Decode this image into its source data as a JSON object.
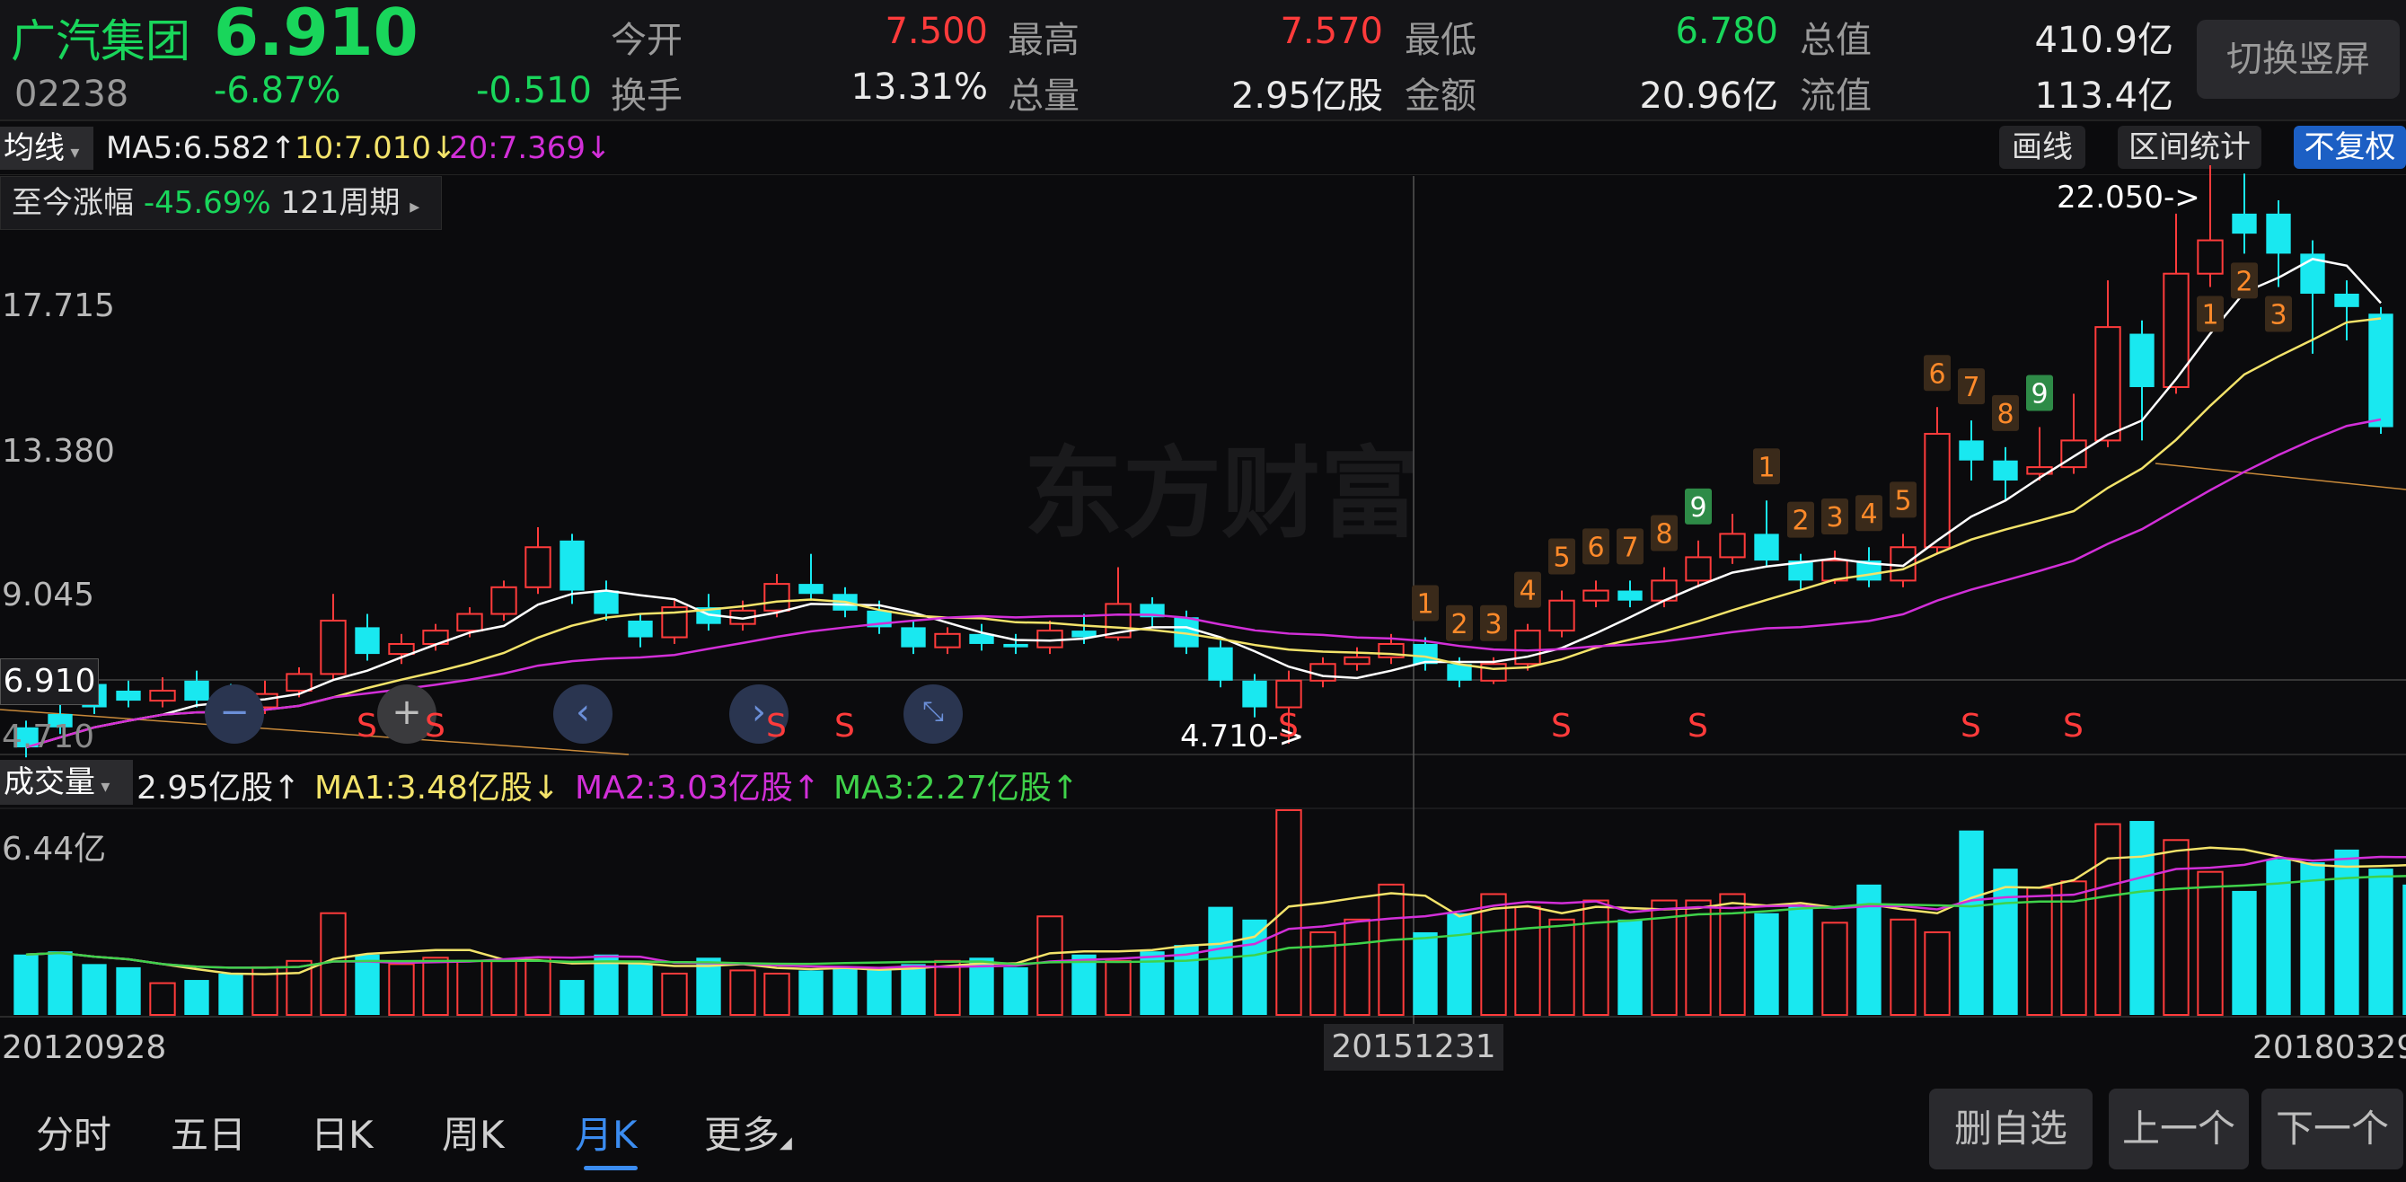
{
  "header": {
    "name": "广汽集团",
    "price": "6.910",
    "code": "02238",
    "change_pct": "-6.87%",
    "change_amt": "-0.510",
    "open_label": "今开",
    "open_value": "7.500",
    "high_label": "最高",
    "high_value": "7.570",
    "low_label": "最低",
    "low_value": "6.780",
    "mktcap_label": "总值",
    "mktcap_value": "410.9亿",
    "turnover_label": "换手",
    "turnover_value": "13.31%",
    "volume_label": "总量",
    "volume_value": "2.95亿股",
    "amount_label": "金额",
    "amount_value": "20.96亿",
    "float_label": "流值",
    "float_value": "113.4亿",
    "switch_label": "切换竖屏"
  },
  "ma_bar": {
    "selector": "均线",
    "ma5": "MA5:6.582↑",
    "ma10": "10:7.010↓",
    "ma20": "20:7.369↓",
    "draw_label": "画线",
    "stats_label": "区间统计",
    "fq_label": "不复权"
  },
  "range": {
    "label": "至今涨幅",
    "pct": "-45.69%",
    "periods": "121周期"
  },
  "watermark": "东方财富",
  "y_axis": [
    "17.715",
    "13.380",
    "9.045"
  ],
  "current_price_tag": "6.910",
  "low_axis_label": "4.710",
  "annotations": {
    "high": "22.050->",
    "low": "4.710->"
  },
  "signal_label": "S",
  "td_up": [
    "1",
    "2",
    "3",
    "4",
    "5",
    "6",
    "7",
    "8",
    "9"
  ],
  "td_up2": [
    "1",
    "2",
    "3",
    "4",
    "5",
    "6",
    "7",
    "8",
    "9"
  ],
  "td_down": [
    "1",
    "2",
    "3"
  ],
  "volume": {
    "selector": "成交量",
    "current": "2.95亿股↑",
    "ma1": "MA1:3.48亿股↓",
    "ma2": "MA2:3.03亿股↑",
    "ma3": "MA3:2.27亿股↑",
    "max": "6.44亿"
  },
  "dates": {
    "start": "20120928",
    "mid": "20151231",
    "end": "20180329"
  },
  "bottom_tabs": [
    "分时",
    "五日",
    "日K",
    "周K",
    "月K",
    "更多"
  ],
  "active_tab": "月K",
  "bottom_buttons": {
    "remove": "删自选",
    "prev": "上一个",
    "next": "下一个"
  },
  "colors": {
    "up": "#ff3b3b",
    "down": "#19d65b",
    "down_candle": "#19e8f0",
    "ma5": "#ffffff",
    "ma10": "#f3e36a",
    "ma20": "#d22fd8",
    "vol_ma3": "#3fd24a"
  },
  "chart_data": {
    "type": "candlestick",
    "period": "monthly",
    "price_scale": {
      "top_label": 17.715,
      "mid_label": 13.38,
      "low_label": 9.045,
      "high": 22.05,
      "low": 4.71
    },
    "candles": [
      {
        "o": 5.2,
        "c": 4.6,
        "h": 5.4,
        "l": 4.3
      },
      {
        "o": 5.6,
        "c": 5.2,
        "h": 6.0,
        "l": 5.0
      },
      {
        "o": 6.5,
        "c": 5.8,
        "h": 6.9,
        "l": 5.6
      },
      {
        "o": 6.3,
        "c": 6.0,
        "h": 6.6,
        "l": 5.8
      },
      {
        "o": 6.0,
        "c": 6.3,
        "h": 6.7,
        "l": 5.8
      },
      {
        "o": 6.6,
        "c": 6.0,
        "h": 6.9,
        "l": 5.8
      },
      {
        "o": 6.2,
        "c": 5.7,
        "h": 6.5,
        "l": 5.4
      },
      {
        "o": 5.8,
        "c": 6.2,
        "h": 6.6,
        "l": 5.6
      },
      {
        "o": 6.3,
        "c": 6.8,
        "h": 7.0,
        "l": 6.1
      },
      {
        "o": 6.8,
        "c": 8.4,
        "h": 9.2,
        "l": 6.6
      },
      {
        "o": 8.2,
        "c": 7.4,
        "h": 8.6,
        "l": 7.2
      },
      {
        "o": 7.4,
        "c": 7.7,
        "h": 8.0,
        "l": 7.1
      },
      {
        "o": 7.7,
        "c": 8.1,
        "h": 8.3,
        "l": 7.5
      },
      {
        "o": 8.1,
        "c": 8.6,
        "h": 8.8,
        "l": 7.9
      },
      {
        "o": 8.6,
        "c": 9.4,
        "h": 9.6,
        "l": 8.4
      },
      {
        "o": 9.4,
        "c": 10.6,
        "h": 11.2,
        "l": 9.2
      },
      {
        "o": 10.8,
        "c": 9.3,
        "h": 11.0,
        "l": 8.9
      },
      {
        "o": 9.3,
        "c": 8.6,
        "h": 9.6,
        "l": 8.4
      },
      {
        "o": 8.4,
        "c": 7.9,
        "h": 8.6,
        "l": 7.6
      },
      {
        "o": 7.9,
        "c": 8.8,
        "h": 9.0,
        "l": 7.7
      },
      {
        "o": 8.8,
        "c": 8.3,
        "h": 9.2,
        "l": 8.1
      },
      {
        "o": 8.3,
        "c": 8.7,
        "h": 9.0,
        "l": 8.1
      },
      {
        "o": 8.7,
        "c": 9.5,
        "h": 9.8,
        "l": 8.5
      },
      {
        "o": 9.5,
        "c": 9.2,
        "h": 10.4,
        "l": 9.0
      },
      {
        "o": 9.2,
        "c": 8.7,
        "h": 9.4,
        "l": 8.5
      },
      {
        "o": 8.7,
        "c": 8.2,
        "h": 9.0,
        "l": 8.0
      },
      {
        "o": 8.2,
        "c": 7.6,
        "h": 8.4,
        "l": 7.4
      },
      {
        "o": 7.6,
        "c": 8.0,
        "h": 8.2,
        "l": 7.4
      },
      {
        "o": 8.0,
        "c": 7.7,
        "h": 8.3,
        "l": 7.5
      },
      {
        "o": 7.7,
        "c": 7.6,
        "h": 8.0,
        "l": 7.4
      },
      {
        "o": 7.6,
        "c": 8.1,
        "h": 8.4,
        "l": 7.4
      },
      {
        "o": 8.1,
        "c": 7.9,
        "h": 8.6,
        "l": 7.7
      },
      {
        "o": 7.9,
        "c": 8.9,
        "h": 10.0,
        "l": 7.8
      },
      {
        "o": 8.9,
        "c": 8.5,
        "h": 9.1,
        "l": 8.2
      },
      {
        "o": 8.5,
        "c": 7.6,
        "h": 8.7,
        "l": 7.4
      },
      {
        "o": 7.6,
        "c": 6.6,
        "h": 7.8,
        "l": 6.4
      },
      {
        "o": 6.6,
        "c": 5.8,
        "h": 6.8,
        "l": 5.5
      },
      {
        "o": 5.8,
        "c": 6.6,
        "h": 6.9,
        "l": 4.71
      },
      {
        "o": 6.6,
        "c": 7.1,
        "h": 7.3,
        "l": 6.4
      },
      {
        "o": 7.1,
        "c": 7.3,
        "h": 7.6,
        "l": 6.9
      },
      {
        "o": 7.3,
        "c": 7.7,
        "h": 8.0,
        "l": 7.1
      },
      {
        "o": 7.7,
        "c": 7.1,
        "h": 7.9,
        "l": 6.9
      },
      {
        "o": 7.1,
        "c": 6.6,
        "h": 7.3,
        "l": 6.4
      },
      {
        "o": 6.6,
        "c": 7.1,
        "h": 7.3,
        "l": 6.5
      },
      {
        "o": 7.1,
        "c": 8.1,
        "h": 8.3,
        "l": 6.9
      },
      {
        "o": 8.1,
        "c": 9.0,
        "h": 9.3,
        "l": 7.9
      },
      {
        "o": 9.0,
        "c": 9.3,
        "h": 9.6,
        "l": 8.8
      },
      {
        "o": 9.3,
        "c": 9.0,
        "h": 9.6,
        "l": 8.8
      },
      {
        "o": 9.0,
        "c": 9.6,
        "h": 10.0,
        "l": 8.8
      },
      {
        "o": 9.6,
        "c": 10.3,
        "h": 10.8,
        "l": 9.4
      },
      {
        "o": 10.3,
        "c": 11.0,
        "h": 11.6,
        "l": 10.1
      },
      {
        "o": 11.0,
        "c": 10.2,
        "h": 12.0,
        "l": 10.0
      },
      {
        "o": 10.2,
        "c": 9.6,
        "h": 10.4,
        "l": 9.3
      },
      {
        "o": 9.6,
        "c": 10.2,
        "h": 10.5,
        "l": 9.5
      },
      {
        "o": 10.2,
        "c": 9.6,
        "h": 10.6,
        "l": 9.4
      },
      {
        "o": 9.6,
        "c": 10.6,
        "h": 11.0,
        "l": 9.4
      },
      {
        "o": 10.6,
        "c": 14.0,
        "h": 14.8,
        "l": 10.4
      },
      {
        "o": 13.8,
        "c": 13.2,
        "h": 14.4,
        "l": 12.6
      },
      {
        "o": 13.2,
        "c": 12.6,
        "h": 13.6,
        "l": 12.0
      },
      {
        "o": 12.8,
        "c": 13.0,
        "h": 14.2,
        "l": 12.6
      },
      {
        "o": 13.0,
        "c": 13.8,
        "h": 15.2,
        "l": 12.8
      },
      {
        "o": 13.8,
        "c": 17.2,
        "h": 18.6,
        "l": 13.6
      },
      {
        "o": 17.0,
        "c": 15.4,
        "h": 17.4,
        "l": 13.8
      },
      {
        "o": 15.4,
        "c": 18.8,
        "h": 20.6,
        "l": 15.2
      },
      {
        "o": 18.8,
        "c": 19.8,
        "h": 22.05,
        "l": 18.4
      },
      {
        "o": 20.6,
        "c": 20.0,
        "h": 21.8,
        "l": 19.4
      },
      {
        "o": 20.6,
        "c": 19.4,
        "h": 21.0,
        "l": 18.4
      },
      {
        "o": 19.4,
        "c": 18.2,
        "h": 19.8,
        "l": 16.4
      },
      {
        "o": 18.2,
        "c": 17.8,
        "h": 18.6,
        "l": 16.8
      },
      {
        "o": 17.6,
        "c": 14.2,
        "h": 17.8,
        "l": 14.0
      }
    ],
    "volume_max": 6.44,
    "volumes": [
      1.9,
      2.0,
      1.6,
      1.5,
      1.0,
      1.1,
      1.3,
      1.5,
      1.7,
      3.2,
      1.9,
      1.6,
      1.8,
      1.7,
      1.7,
      1.8,
      1.1,
      1.9,
      1.6,
      1.3,
      1.8,
      1.4,
      1.3,
      1.4,
      1.5,
      1.5,
      1.6,
      1.7,
      1.8,
      1.5,
      3.1,
      1.9,
      1.7,
      2.0,
      2.2,
      3.4,
      3.0,
      6.44,
      2.6,
      3.0,
      4.1,
      2.6,
      3.2,
      3.8,
      3.4,
      3.0,
      3.6,
      3.0,
      3.6,
      3.6,
      3.8,
      3.2,
      3.4,
      2.9,
      4.1,
      3.0,
      2.6,
      5.8,
      4.6,
      4.0,
      4.2,
      6.0,
      6.1,
      5.5,
      4.5,
      3.9,
      4.9,
      4.8,
      5.2,
      4.6,
      4.1
    ],
    "ma_lines": [
      "MA5",
      "MA10",
      "MA20"
    ],
    "vol_ma_lines": [
      "MA1",
      "MA2",
      "MA3"
    ]
  }
}
